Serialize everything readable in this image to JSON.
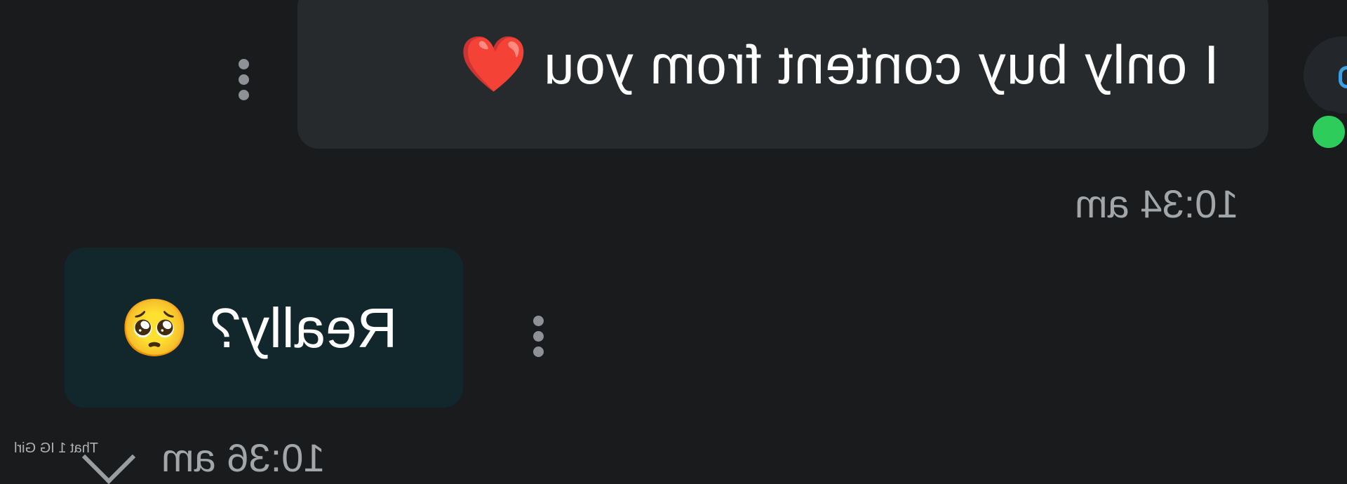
{
  "messages": [
    {
      "text": "I only buy content from you",
      "emoji": "❤️",
      "time": "10:34 am",
      "direction": "outgoing"
    },
    {
      "text": "Really?",
      "emoji": "🥺",
      "time": "10:36 am",
      "direction": "incoming"
    }
  ],
  "watermark": "That 1 IG Girl",
  "icons": {
    "more": "more-vertical-icon",
    "scroll_down": "chevron-down-icon",
    "online": "online-status-dot"
  },
  "colors": {
    "background": "#1a1b1d",
    "outgoing_bubble": "#262a2d",
    "incoming_bubble": "#12272c",
    "timestamp": "#a3a6a9",
    "online": "#2ecc5a"
  }
}
